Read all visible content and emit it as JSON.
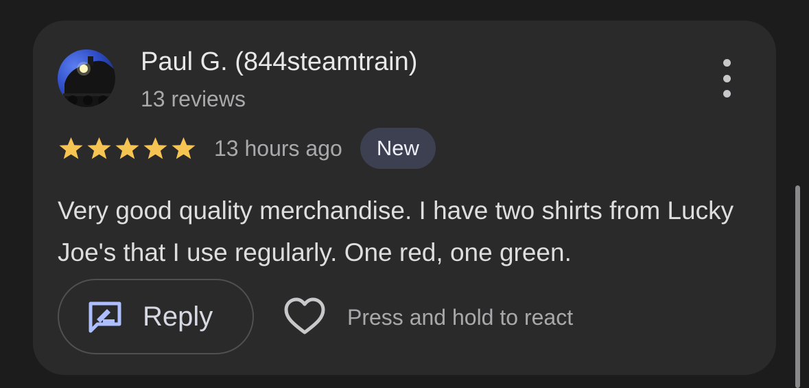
{
  "review": {
    "author_name": "Paul G. (844steamtrain)",
    "author_review_count": "13 reviews",
    "rating": 5,
    "rating_max": 5,
    "time_ago": "13 hours ago",
    "badge": "New",
    "text": "Very good quality merchandise. I have two shirts from Lucky Joe's that I use regularly. One red, one green."
  },
  "actions": {
    "reply_label": "Reply",
    "react_hint": "Press and hold to react",
    "icons": {
      "reply": "reply-edit-icon",
      "react": "heart-outline-icon",
      "more": "more-vertical-icon",
      "avatar": "steam-train-avatar"
    }
  },
  "colors": {
    "star": "#f5c452",
    "badge_bg": "#3d4050",
    "reply_icon": "#aebfff",
    "card_bg": "#2a2a2b"
  }
}
